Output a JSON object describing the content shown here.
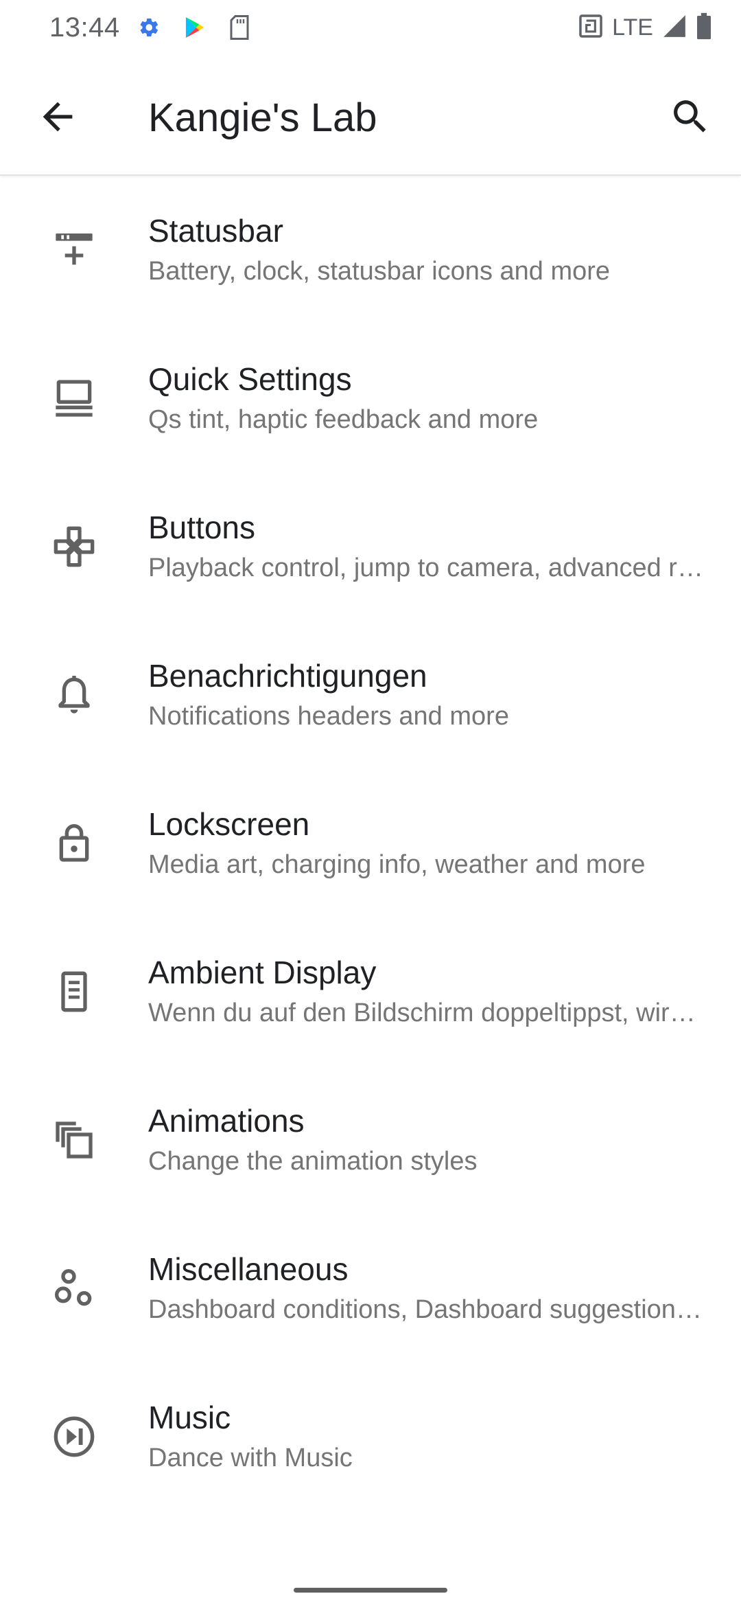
{
  "status_bar": {
    "time": "13:44",
    "network": "LTE",
    "icons": [
      "settings-gear-icon",
      "play-store-icon",
      "sd-card-icon",
      "nfc-icon",
      "signal-icon",
      "battery-icon"
    ]
  },
  "app_bar": {
    "title": "Kangie's Lab",
    "back_icon": "arrow-back-icon",
    "search_icon": "search-icon"
  },
  "colors": {
    "icon_gray": "#616161",
    "subtitle_gray": "#757575",
    "title": "#202124"
  },
  "items": [
    {
      "icon": "statusbar-icon",
      "title": "Statusbar",
      "subtitle": "Battery, clock, statusbar icons and more"
    },
    {
      "icon": "quick-settings-icon",
      "title": "Quick Settings",
      "subtitle": "Qs tint, haptic feedback and more"
    },
    {
      "icon": "gamepad-icon",
      "title": "Buttons",
      "subtitle": "Playback control, jump to camera, advanced restart and more"
    },
    {
      "icon": "bell-icon",
      "title": "Benachrichtigungen",
      "subtitle": "Notifications headers and more"
    },
    {
      "icon": "lock-icon",
      "title": "Lockscreen",
      "subtitle": "Media art, charging info, weather and more"
    },
    {
      "icon": "device-doc-icon",
      "title": "Ambient Display",
      "subtitle": "Wenn du auf den Bildschirm doppeltippst, wird er aktiviert"
    },
    {
      "icon": "copy-layers-icon",
      "title": "Animations",
      "subtitle": "Change the animation styles"
    },
    {
      "icon": "bubbles-icon",
      "title": "Miscellaneous",
      "subtitle": "Dashboard conditions, Dashboard suggestions and more"
    },
    {
      "icon": "play-pause-circle-icon",
      "title": "Music",
      "subtitle": "Dance with Music"
    }
  ]
}
